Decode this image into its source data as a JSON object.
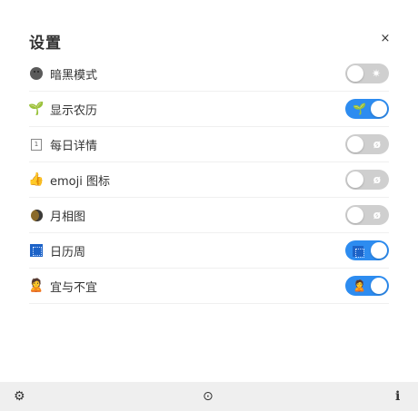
{
  "header": {
    "title": "设置",
    "close_label": "×"
  },
  "settings": [
    {
      "label": "暗黑模式",
      "icon": "neutral-face-icon",
      "on": false,
      "symbol": "✷"
    },
    {
      "label": "显示农历",
      "icon": "seedling-icon",
      "on": true,
      "symbol": "🌱"
    },
    {
      "label": "每日详情",
      "icon": "calendar-one-icon",
      "on": false,
      "symbol": "ø"
    },
    {
      "label": "emoji 图标",
      "icon": "thumbs-up-icon",
      "on": false,
      "symbol": "ø"
    },
    {
      "label": "月相图",
      "icon": "moon-phase-icon",
      "on": false,
      "symbol": "ø"
    },
    {
      "label": "日历周",
      "icon": "week-calendar-icon",
      "on": true,
      "symbol": "📅"
    },
    {
      "label": "宜与不宜",
      "icon": "person-icon",
      "on": true,
      "symbol": "🙎"
    }
  ],
  "footer": {
    "settings_icon": "⚙",
    "history_icon": "⊙",
    "info_icon": "i"
  },
  "colors": {
    "toggle_on": "#2d8cf0",
    "toggle_off": "#cfcfcf",
    "footer_bg": "#efefef"
  }
}
